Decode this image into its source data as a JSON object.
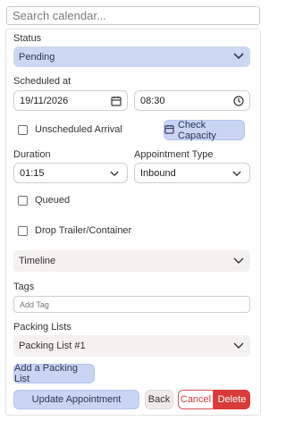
{
  "search": {
    "placeholder": "Search calendar..."
  },
  "status": {
    "label": "Status",
    "value": "Pending"
  },
  "scheduled": {
    "label": "Scheduled at",
    "date": "19/11/2026",
    "time": "08:30"
  },
  "unscheduled_arrival": {
    "label": "Unscheduled Arrival",
    "checked": false
  },
  "check_capacity": {
    "label": "Check Capacity"
  },
  "duration": {
    "label": "Duration",
    "value": "01:15"
  },
  "appointment_type": {
    "label": "Appointment Type",
    "value": "Inbound"
  },
  "queued": {
    "label": "Queued",
    "checked": false
  },
  "drop_trailer": {
    "label": "Drop Trailer/Container",
    "checked": false
  },
  "timeline": {
    "label": "Timeline"
  },
  "tags": {
    "label": "Tags",
    "placeholder": "Add Tag"
  },
  "packing_lists": {
    "label": "Packing Lists",
    "items": [
      {
        "label": "Packing List #1"
      }
    ],
    "add_label": "Add a Packing List"
  },
  "actions": {
    "update": "Update Appointment",
    "back": "Back",
    "cancel": "Cancel",
    "delete": "Delete"
  },
  "colors": {
    "primary_soft": "#c9d5f2",
    "danger": "#d93a3a",
    "neutral": "#efebe9"
  },
  "icons": {
    "chevron": "chevron-down-icon",
    "calendar": "calendar-icon",
    "clock": "clock-icon"
  }
}
